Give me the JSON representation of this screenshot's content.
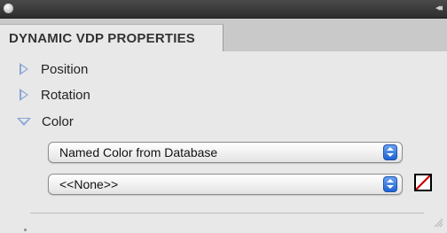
{
  "panel": {
    "tab_title": "DYNAMIC VDP PROPERTIES",
    "sections": [
      {
        "label": "Position",
        "expanded": false
      },
      {
        "label": "Rotation",
        "expanded": false
      },
      {
        "label": "Color",
        "expanded": true
      }
    ],
    "color_source_select": {
      "value": "Named Color from Database"
    },
    "color_name_select": {
      "value": "<<None>>"
    },
    "swatch": {
      "state": "none",
      "slash_color": "#cc0000"
    }
  },
  "icons": {
    "close": "close-icon",
    "collapse": "collapse-panel-icon",
    "disclosure_collapsed": "disclosure-triangle-right-icon",
    "disclosure_expanded": "disclosure-triangle-down-icon",
    "select_arrows": "popup-arrows-icon",
    "resize": "resize-grip-icon"
  },
  "colors": {
    "accent": "#8aa6d6",
    "select_arrow": "#1f63d6"
  }
}
